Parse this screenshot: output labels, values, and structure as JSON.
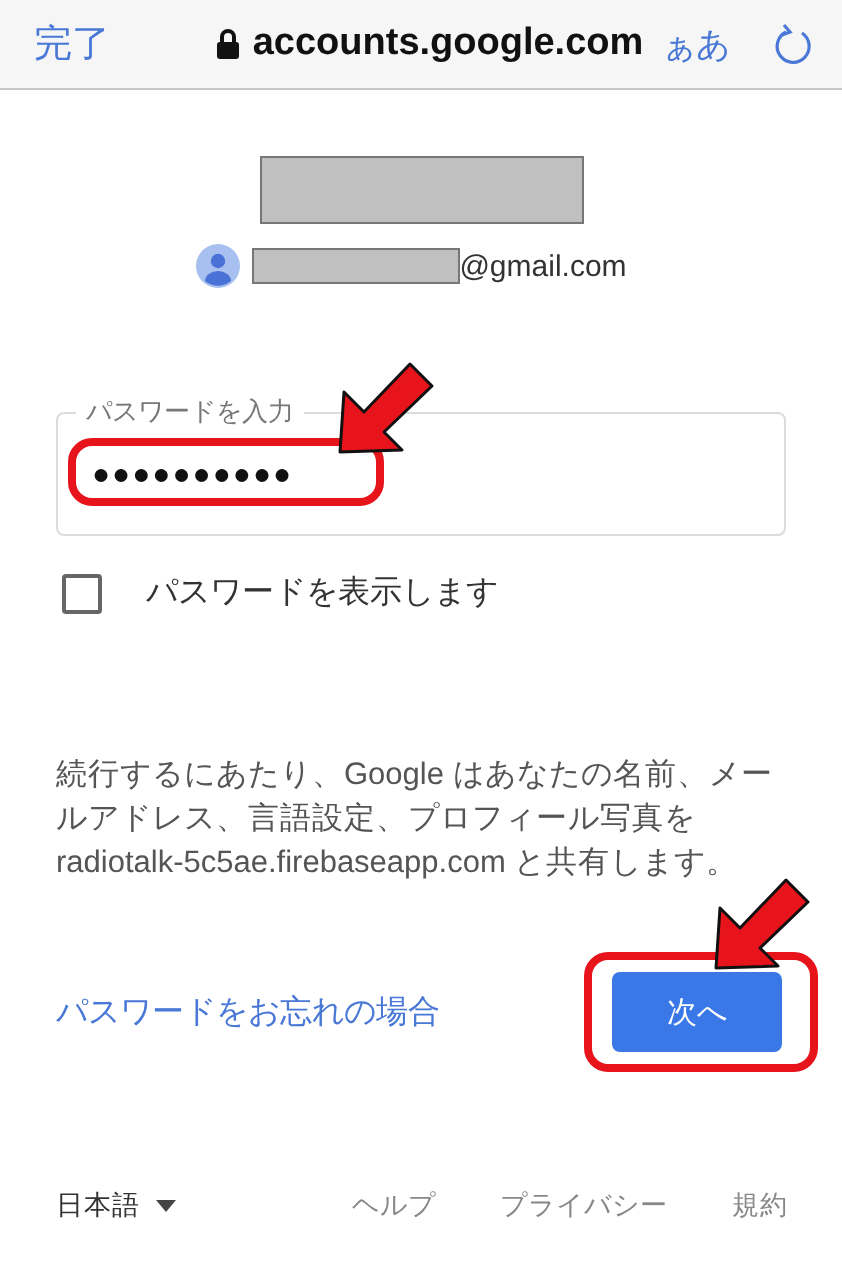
{
  "browser_bar": {
    "done": "完了",
    "url": "accounts.google.com",
    "text_size": "ぁあ"
  },
  "account": {
    "email_suffix": "@gmail.com"
  },
  "password_field": {
    "label": "パスワードを入力",
    "value": "●●●●●●●●●●"
  },
  "show_password": {
    "label": "パスワードを表示します",
    "checked": false
  },
  "consent_text": "続行するにあたり、Google はあなたの名前、メールアドレス、言語設定、プロフィール写真を radiotalk-5c5ae.firebaseapp.com と共有します。",
  "forgot_link": "パスワードをお忘れの場合",
  "next_button": "次へ",
  "footer": {
    "language": "日本語",
    "links": [
      "ヘルプ",
      "プライバシー",
      "規約"
    ]
  }
}
